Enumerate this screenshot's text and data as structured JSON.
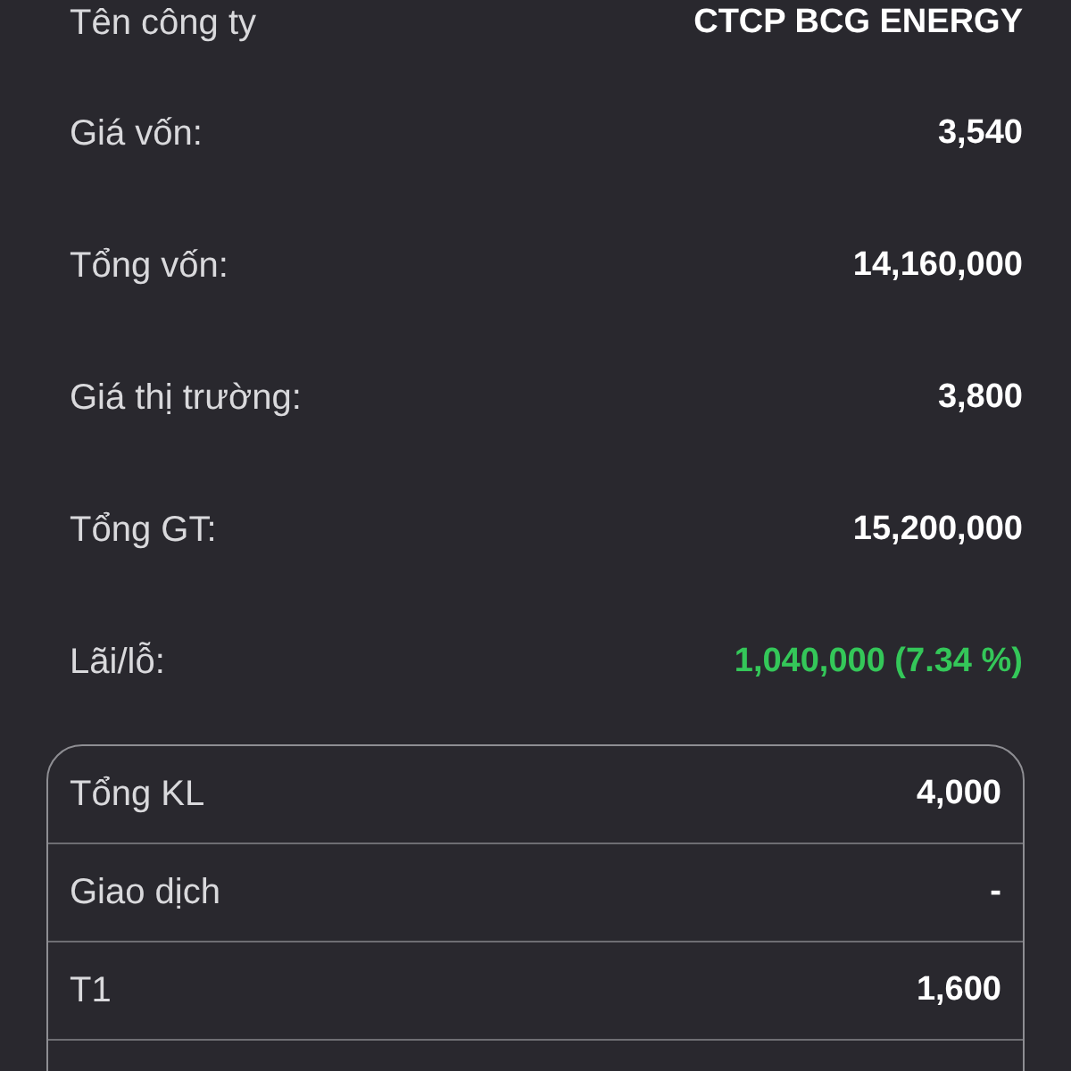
{
  "details": [
    {
      "label": "Tên công ty",
      "value": "CTCP BCG ENERGY",
      "kind": "neutral"
    },
    {
      "label": "Giá vốn:",
      "value": "3,540",
      "kind": "neutral"
    },
    {
      "label": "Tổng vốn:",
      "value": "14,160,000",
      "kind": "neutral"
    },
    {
      "label": "Giá thị trường:",
      "value": "3,800",
      "kind": "neutral"
    },
    {
      "label": "Tổng GT:",
      "value": "15,200,000",
      "kind": "neutral"
    },
    {
      "label": "Lãi/lỗ:",
      "value": "1,040,000 (7.34 %)",
      "kind": "gain"
    }
  ],
  "summary": [
    {
      "label": "Tổng KL",
      "value": "4,000"
    },
    {
      "label": "Giao dịch",
      "value": "-"
    },
    {
      "label": "T1",
      "value": "1,600"
    }
  ]
}
